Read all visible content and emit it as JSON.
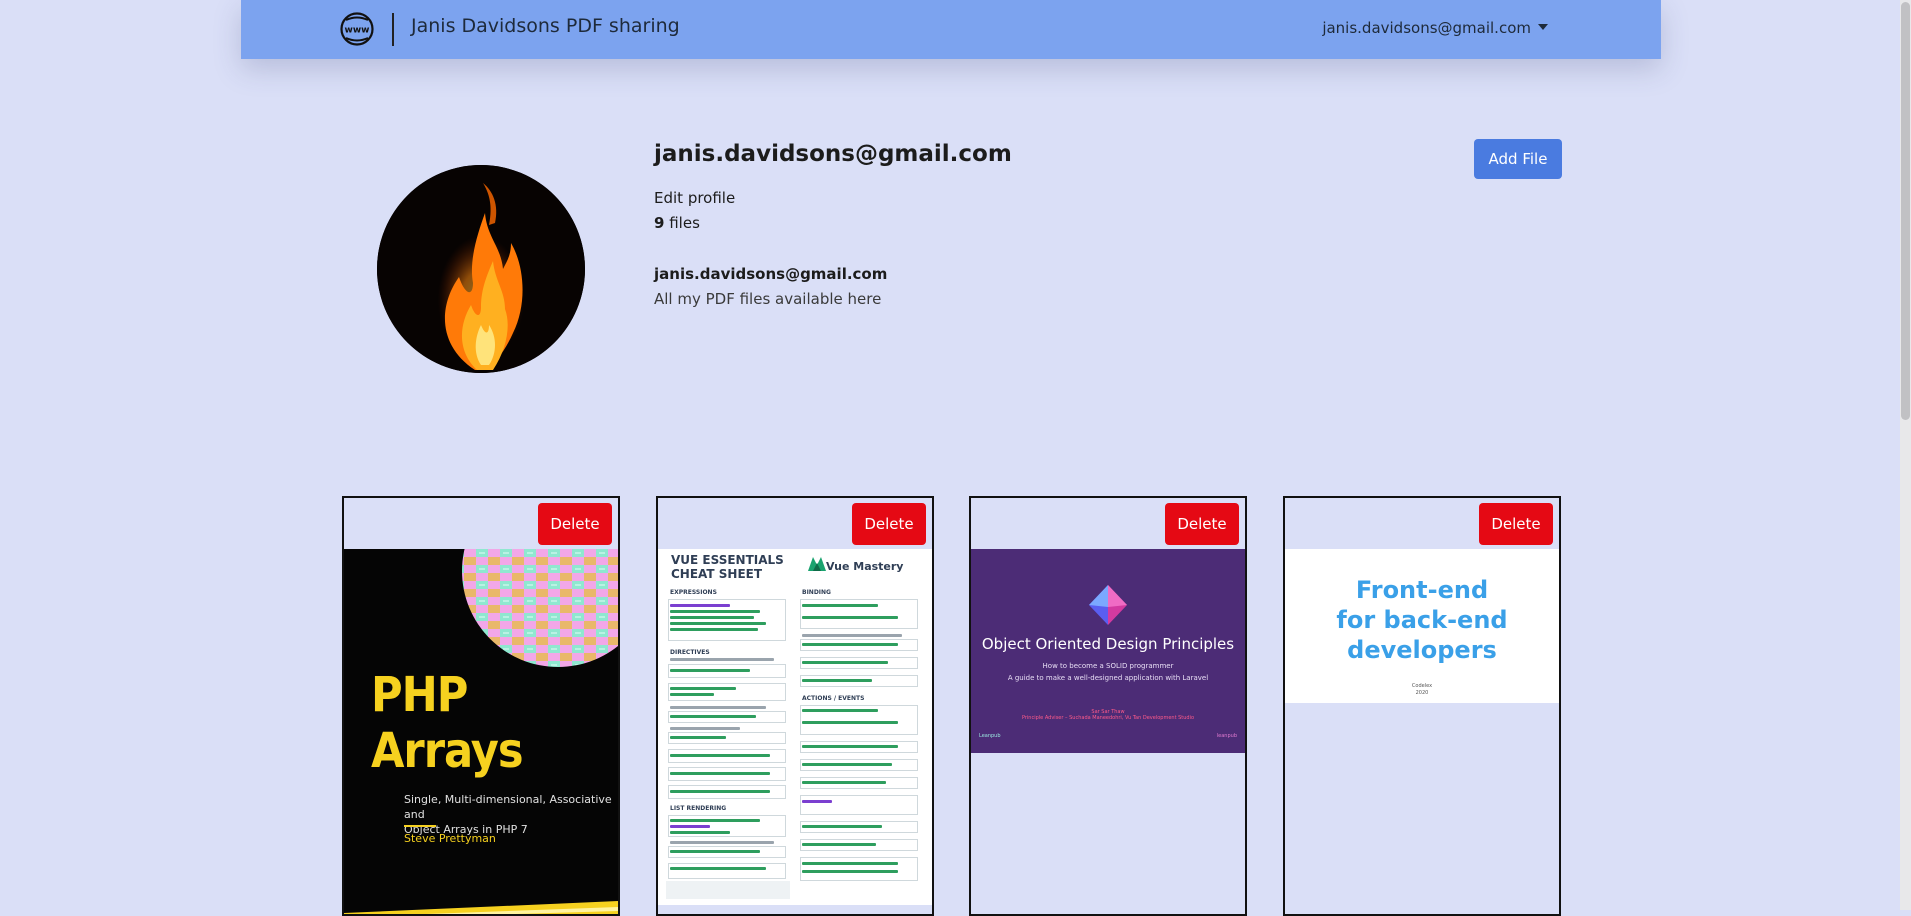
{
  "navbar": {
    "brand_icon": "www-globe-icon",
    "brand_icon_text": "www",
    "brand_title": "Janis Davidsons PDF sharing",
    "user_menu_label": "janis.davidsons@gmail.com"
  },
  "profile": {
    "username": "janis.davidsons@gmail.com",
    "edit_profile_label": "Edit profile",
    "files_count": "9",
    "files_label": "files",
    "bio_email": "janis.davidsons@gmail.com",
    "bio_text": "All my PDF files available here",
    "avatar_icon": "fire-image",
    "add_file_label": "Add File"
  },
  "files": [
    {
      "delete_label": "Delete",
      "cover": {
        "title_line1": "PHP",
        "title_line2": "Arrays",
        "subtitle_line1": "Single, Multi-dimensional, Associative and",
        "subtitle_line2": "Object Arrays in PHP 7",
        "author": "Steve Prettyman"
      }
    },
    {
      "delete_label": "Delete",
      "cover": {
        "title_line1": "VUE ESSENTIALS",
        "title_line2": "CHEAT SHEET",
        "brand": "Vue Mastery",
        "sections": [
          "EXPRESSIONS",
          "DIRECTIVES",
          "LIST RENDERING",
          "BINDING",
          "ACTIONS / EVENTS"
        ]
      }
    },
    {
      "delete_label": "Delete",
      "cover": {
        "title": "Object Oriented Design Principles",
        "subtitle1": "How to become a SOLID programmer",
        "subtitle2": "A guide to make a well-designed application with Laravel",
        "author1": "Sar Sar Thaw",
        "author2": "Principle Adviser – Suchada Maneedohri, Vu Tan Development Studio",
        "publisher_left": "Leanpub",
        "publisher_right": "leanpub"
      }
    },
    {
      "delete_label": "Delete",
      "cover": {
        "title_line1": "Front-end",
        "title_line2": "for back-end",
        "title_line3": "developers",
        "publisher": "Codelex",
        "year": "2020"
      }
    }
  ],
  "colors": {
    "page_bg": "#dadff7",
    "navbar_bg": "#7ca3ef",
    "primary_button": "#4a7be0",
    "danger_button": "#e50914"
  }
}
